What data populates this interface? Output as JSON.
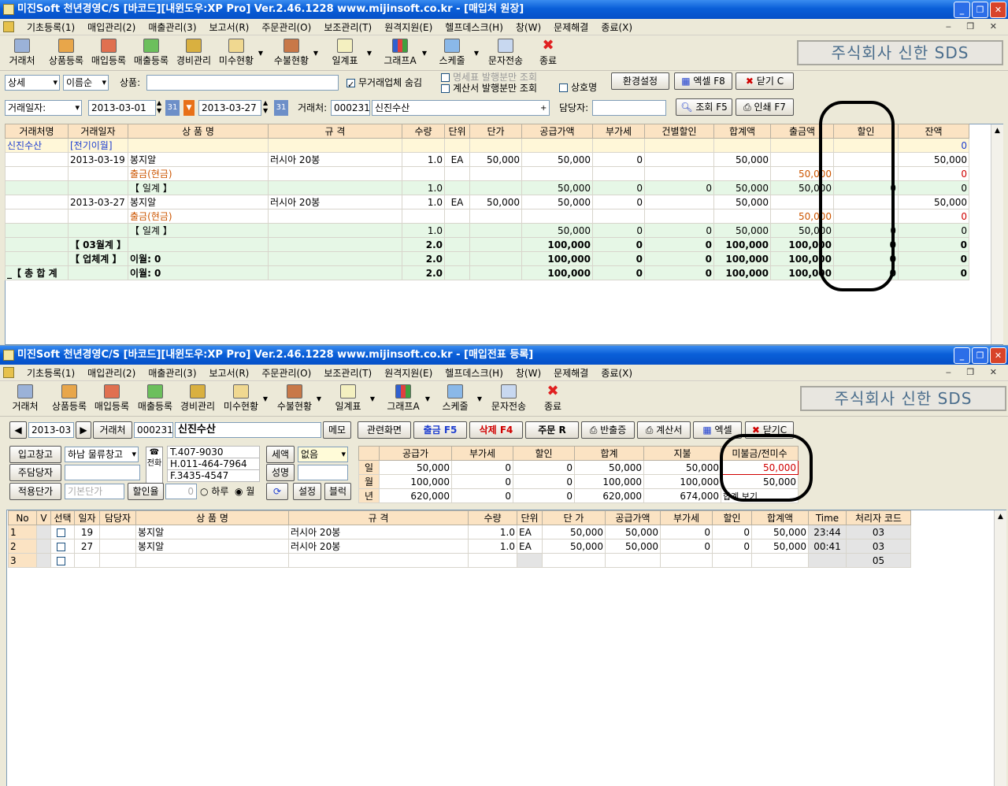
{
  "win1": {
    "title": "미진Soft 천년경영C/S [바코드][내윈도우:XP Pro] Ver.2.46.1228        www.mijinsoft.co.kr - [매입처 원장]",
    "menu": [
      "기초등록(1)",
      "매입관리(2)",
      "매출관리(3)",
      "보고서(R)",
      "주문관리(O)",
      "보조관리(T)",
      "원격지원(E)",
      "헬프데스크(H)",
      "창(W)",
      "문제해결",
      "종료(X)"
    ],
    "toolbar": [
      "거래처",
      "상품등록",
      "매입등록",
      "매출등록",
      "경비관리",
      "미수현황",
      "수불현황",
      "일계표",
      "그래프A",
      "스케줄",
      "문자전송",
      "종료"
    ],
    "company": "주식회사 신한 SDS",
    "filters": {
      "detail": "상세",
      "sort": "이름순",
      "product_label": "상품:",
      "product_value": "",
      "hide_inactive": "무거래업체 숨김",
      "stmt_only": "명세표 발행분만 조회",
      "invoice_only": "계산서 발행분만 조회",
      "company_name": "상호명",
      "settings": "환경설정",
      "excel": "엑셀 F8",
      "close": "닫기 C",
      "date_type": "거래일자:",
      "date_from": "2013-03-01",
      "date_to": "2013-03-27",
      "partner_label": "거래처:",
      "partner_code": "000231",
      "partner_name": "신진수산",
      "manager_label": "담당자:",
      "manager_value": "",
      "search": "조회 F5",
      "print": "인쇄 F7"
    },
    "ledger": {
      "columns": [
        "거래처명",
        "거래일자",
        "상 품 명",
        "규 격",
        "수량",
        "단위",
        "단가",
        "공급가액",
        "부가세",
        "건별할인",
        "합계액",
        "출금액",
        "할인",
        "잔액"
      ],
      "rows": [
        {
          "style": "cream",
          "cells": [
            "신진수산",
            "[전기이월]",
            "",
            "",
            "",
            "",
            "",
            "",
            "",
            "",
            "",
            "",
            "",
            "0"
          ]
        },
        {
          "style": "white",
          "cells": [
            "",
            "2013-03-19",
            "봉지알",
            "러시아 20봉",
            "1.0",
            "EA",
            "50,000",
            "50,000",
            "0",
            "",
            "50,000",
            "",
            "",
            "50,000"
          ]
        },
        {
          "style": "white",
          "cells": [
            "",
            "",
            "출금(현금)",
            "",
            "",
            "",
            "",
            "",
            "",
            "",
            "",
            "50,000",
            "",
            "0"
          ]
        },
        {
          "style": "sub",
          "cells": [
            "",
            "",
            "【 일계 】",
            "",
            "1.0",
            "",
            "",
            "50,000",
            "0",
            "0",
            "50,000",
            "50,000",
            "0",
            "0"
          ]
        },
        {
          "style": "white",
          "cells": [
            "",
            "2013-03-27",
            "봉지알",
            "러시아 20봉",
            "1.0",
            "EA",
            "50,000",
            "50,000",
            "0",
            "",
            "50,000",
            "",
            "",
            "50,000"
          ]
        },
        {
          "style": "white",
          "cells": [
            "",
            "",
            "출금(현금)",
            "",
            "",
            "",
            "",
            "",
            "",
            "",
            "",
            "50,000",
            "",
            "0"
          ]
        },
        {
          "style": "sub",
          "cells": [
            "",
            "",
            "【 일계 】",
            "",
            "1.0",
            "",
            "",
            "50,000",
            "0",
            "0",
            "50,000",
            "50,000",
            "0",
            "0"
          ]
        },
        {
          "style": "sub",
          "cells": [
            "",
            "【 03월계 】",
            "",
            "",
            "2.0",
            "",
            "",
            "100,000",
            "0",
            "0",
            "100,000",
            "100,000",
            "0",
            "0"
          ]
        },
        {
          "style": "sub",
          "cells": [
            "",
            "【 업체계 】",
            "이월: 0",
            "",
            "2.0",
            "",
            "",
            "100,000",
            "0",
            "0",
            "100,000",
            "100,000",
            "0",
            "0"
          ]
        },
        {
          "style": "sub",
          "cells": [
            "_【 총 합 계",
            "",
            "이월: 0",
            "",
            "2.0",
            "",
            "",
            "100,000",
            "0",
            "0",
            "100,000",
            "100,000",
            "0",
            "0"
          ]
        }
      ]
    }
  },
  "win2": {
    "title": "미진Soft 천년경영C/S [바코드][내윈도우:XP Pro] Ver.2.46.1228        www.mijinsoft.co.kr - [매입전표 등록]",
    "menu": [
      "기초등록(1)",
      "매입관리(2)",
      "매출관리(3)",
      "보고서(R)",
      "주문관리(O)",
      "보조관리(T)",
      "원격지원(E)",
      "헬프데스크(H)",
      "창(W)",
      "문제해결",
      "종료(X)"
    ],
    "toolbar": [
      "거래처",
      "상품등록",
      "매입등록",
      "매출등록",
      "경비관리",
      "미수현황",
      "수불현황",
      "일계표",
      "그래프A",
      "스케줄",
      "문자전송",
      "종료"
    ],
    "company": "주식회사 신한 SDS",
    "form": {
      "month": "2013-03",
      "partner_label": "거래처",
      "partner_code": "000231",
      "partner_name": "신진수산",
      "memo": "메모",
      "warehouse_label": "입고창고",
      "warehouse": "하남 물류창고",
      "phone_label": "전화",
      "tel": "T.407-9030",
      "hp": "H.011-464-7964",
      "fax": "F.3435-4547",
      "tax_label": "세액",
      "tax_value": "없음",
      "manager_label": "주담당자",
      "manager_value": "",
      "name_label": "성명",
      "name_value": "",
      "price_label": "적용단가",
      "price_value": "기본단가",
      "discount_label": "할인율",
      "discount_value": "0",
      "opt_day": "하루",
      "opt_month": "월",
      "setup": "설정",
      "block": "블럭"
    },
    "actions": [
      "관련화면",
      "출금 F5",
      "삭제 F4",
      "주문 R",
      "반출증",
      "계산서",
      "엑셀",
      "닫기C"
    ],
    "summary": {
      "columns": [
        "",
        "공급가",
        "부가세",
        "할인",
        "합계",
        "지불",
        "미불금/전미수"
      ],
      "rows": [
        [
          "일",
          "50,000",
          "0",
          "0",
          "50,000",
          "50,000",
          "50,000"
        ],
        [
          "월",
          "100,000",
          "0",
          "0",
          "100,000",
          "100,000",
          "50,000"
        ],
        [
          "년",
          "620,000",
          "0",
          "0",
          "620,000",
          "674,000",
          "합계 보기"
        ]
      ]
    },
    "lines": {
      "columns": [
        "No",
        "V",
        "선택",
        "일자",
        "담당자",
        "상 품 명",
        "규 격",
        "수량",
        "단위",
        "단 가",
        "공급가액",
        "부가세",
        "할인",
        "합계액",
        "Time",
        "처리자 코드"
      ],
      "rows": [
        [
          "1",
          "",
          "",
          "19",
          "",
          "봉지알",
          "러시아 20봉",
          "1.0",
          "EA",
          "50,000",
          "50,000",
          "0",
          "0",
          "50,000",
          "23:44",
          "03"
        ],
        [
          "2",
          "",
          "",
          "27",
          "",
          "봉지알",
          "러시아 20봉",
          "1.0",
          "EA",
          "50,000",
          "50,000",
          "0",
          "0",
          "50,000",
          "00:41",
          "03"
        ],
        [
          "3",
          "",
          "",
          "",
          "",
          "",
          "",
          "",
          "",
          "",
          "",
          "",
          "",
          "",
          "",
          "05"
        ]
      ]
    }
  }
}
